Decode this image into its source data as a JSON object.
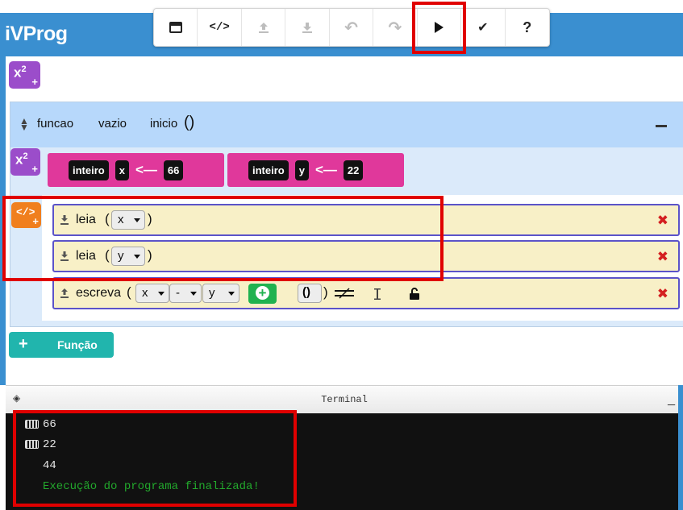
{
  "app": {
    "title": "iVProg"
  },
  "toolbar": {
    "buttons": [
      {
        "name": "window",
        "glyph": "▭"
      },
      {
        "name": "code",
        "glyph": "</>"
      },
      {
        "name": "upload",
        "glyph": "⇪"
      },
      {
        "name": "download",
        "glyph": "⇩"
      },
      {
        "name": "undo",
        "glyph": "↶"
      },
      {
        "name": "redo",
        "glyph": "↷"
      },
      {
        "name": "run",
        "glyph": "▶"
      },
      {
        "name": "check",
        "glyph": "✔"
      },
      {
        "name": "help",
        "glyph": "?"
      }
    ]
  },
  "global_vars": {
    "button_base": "x",
    "button_exp": "2",
    "button_plus": "+"
  },
  "function": {
    "keyword": "funcao",
    "return_type": "vazio",
    "name": "inicio",
    "parens": "()",
    "variables": [
      {
        "type": "inteiro",
        "name": "x",
        "arrow": "<—",
        "value": "66"
      },
      {
        "type": "inteiro",
        "name": "y",
        "arrow": "<—",
        "value": "22"
      }
    ],
    "commands": [
      {
        "name": "leia",
        "open": "(",
        "close": ")",
        "var": "x",
        "delete": "✖"
      },
      {
        "name": "leia",
        "open": "(",
        "close": ")",
        "var": "y",
        "delete": "✖"
      },
      {
        "name": "escreva",
        "open": "(",
        "close": ")",
        "expr": [
          "x",
          "-",
          "y"
        ],
        "add": "+",
        "paren_btn": "()",
        "delete": "✖"
      }
    ]
  },
  "add_function": {
    "plus": "+",
    "label": "Função"
  },
  "terminal": {
    "title": "Terminal",
    "clear_icon": "◈",
    "minimize_icon": "_",
    "lines": [
      {
        "text": "66",
        "input": true
      },
      {
        "text": "22",
        "input": true
      },
      {
        "text": "44",
        "input": false
      },
      {
        "text": "Execução do programa finalizada!",
        "input": false,
        "status": "done"
      }
    ]
  },
  "colors": {
    "header": "#3a8fd0",
    "var_block": "#e0389b",
    "command_bg": "#f8f0c7",
    "command_border": "#5b53c9",
    "var_button": "#9b4dca",
    "command_button": "#f07f1e",
    "function_button": "#21b5ad",
    "highlight": "#e00000",
    "terminal_done": "#22a82c"
  }
}
